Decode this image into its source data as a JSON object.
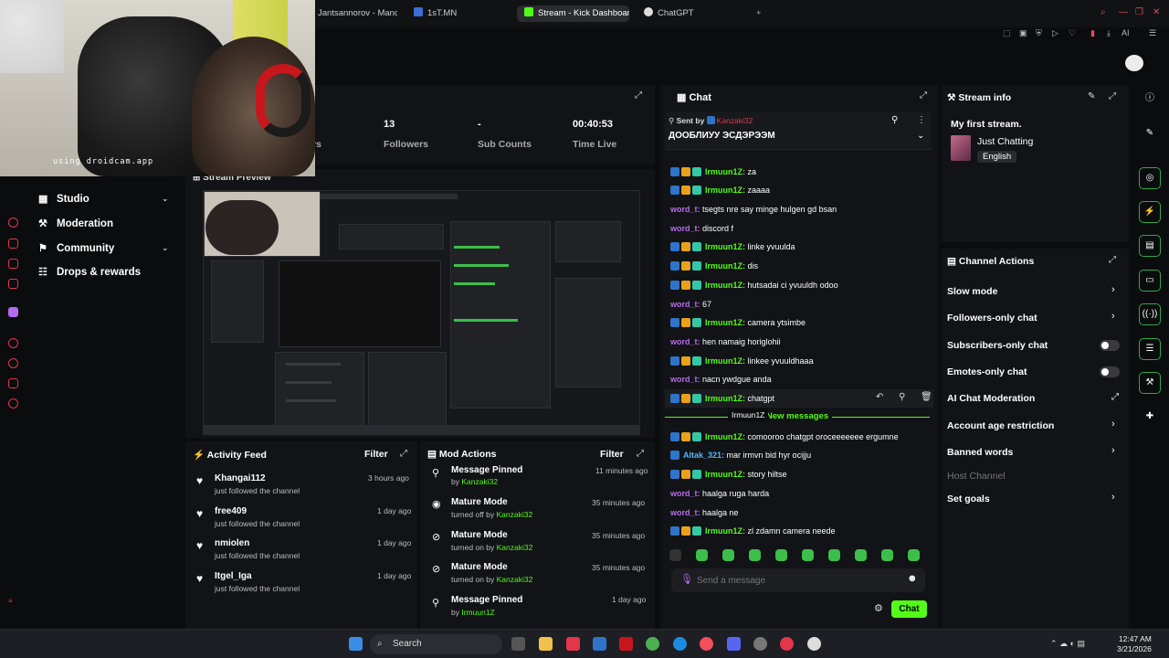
{
  "browser": {
    "tabs": [
      {
        "label": "Jantsannorov - Mand..."
      },
      {
        "label": "1sT.MN"
      },
      {
        "label": "Stream - Kick Dashboard"
      },
      {
        "label": "ChatGPT"
      }
    ],
    "new_tab": "+",
    "toolbar_ai": "AI"
  },
  "webcam": {
    "watermark": "using droidcam.app"
  },
  "nav": {
    "items": [
      {
        "label": "Studio",
        "icon": "studio-icon",
        "has_chevron": true
      },
      {
        "label": "Moderation",
        "icon": "moderation-icon",
        "has_chevron": false
      },
      {
        "label": "Community",
        "icon": "community-icon",
        "has_chevron": true
      },
      {
        "label": "Drops & rewards",
        "icon": "drops-icon",
        "has_chevron": false
      }
    ]
  },
  "stats": [
    {
      "value": "13",
      "label": "Followers"
    },
    {
      "value": "-",
      "label": "Sub Counts"
    },
    {
      "value": "00:40:53",
      "label": "Time Live"
    }
  ],
  "stats_partial_label": "rs",
  "preview": {
    "title": "Stream Preview"
  },
  "activity_feed": {
    "title": "Activity Feed",
    "filter": "Filter",
    "items": [
      {
        "name": "Khangai112",
        "sub": "just followed the channel",
        "time": "3 hours ago"
      },
      {
        "name": "free409",
        "sub": "just followed the channel",
        "time": "1 day ago"
      },
      {
        "name": "nmiolen",
        "sub": "just followed the channel",
        "time": "1 day ago"
      },
      {
        "name": "Itgel_Iga",
        "sub": "just followed the channel",
        "time": "1 day ago"
      }
    ]
  },
  "mod_actions": {
    "title": "Mod Actions",
    "filter": "Filter",
    "items": [
      {
        "action": "Message Pinned",
        "prefix": "by",
        "user": "Kanzaki32",
        "time": "11 minutes ago",
        "icon": "pin-icon"
      },
      {
        "action": "Mature Mode",
        "prefix": "turned off by",
        "user": "Kanzaki32",
        "time": "35 minutes ago",
        "icon": "eye-icon"
      },
      {
        "action": "Mature Mode",
        "prefix": "turned on by",
        "user": "Kanzaki32",
        "time": "35 minutes ago",
        "icon": "eye-off-icon"
      },
      {
        "action": "Mature Mode",
        "prefix": "turned on by",
        "user": "Kanzaki32",
        "time": "35 minutes ago",
        "icon": "eye-off-icon"
      },
      {
        "action": "Message Pinned",
        "prefix": "by",
        "user": "Irmuun1Z",
        "time": "1 day ago",
        "icon": "pin-icon"
      }
    ]
  },
  "chat": {
    "title": "Chat",
    "pinned": {
      "sent_by": "Sent by",
      "user": "Kanzaki32",
      "text": "ДООБЛИУУ ЭСДЭРЭЭМ"
    },
    "messages": [
      {
        "user": "Irmuun1Z:",
        "text": "za",
        "badges": true
      },
      {
        "user": "Irmuun1Z:",
        "text": "zaaaa",
        "badges": true
      },
      {
        "user": "word_t:",
        "text": "tsegts nre say minge hulgen gd bsan",
        "badges": false
      },
      {
        "user": "word_t:",
        "text": "discord f",
        "badges": false
      },
      {
        "user": "Irmuun1Z:",
        "text": "linke yvuulda",
        "badges": true
      },
      {
        "user": "Irmuun1Z:",
        "text": "dis",
        "badges": true
      },
      {
        "user": "Irmuun1Z:",
        "text": "hutsadai ci yvuuldh odoo",
        "badges": true
      },
      {
        "user": "word_t:",
        "text": "67",
        "badges": false
      },
      {
        "user": "Irmuun1Z:",
        "text": "camera ytsimbe",
        "badges": true
      },
      {
        "user": "word_t:",
        "text": "hen namaig horiglohii",
        "badges": false
      },
      {
        "user": "Irmuun1Z:",
        "text": "linkee yvuuldhaaa",
        "badges": true
      },
      {
        "user": "word_t:",
        "text": "nacn ywdgue anda",
        "badges": false
      },
      {
        "user": "Irmuun1Z:",
        "text": "chatgpt",
        "badges": true
      }
    ],
    "new_messages": "New messages",
    "tooltip": "Irmuun1Z",
    "messages_after": [
      {
        "user": "Irmuun1Z:",
        "text": "comooroo chatgpt oroceeeeeee ergumne",
        "badges": true
      },
      {
        "user": "Altak_321:",
        "text": "mar irmvn bid hyr ocijju",
        "badges": "single"
      },
      {
        "user": "Irmuun1Z:",
        "text": "story hiltse",
        "badges": true
      },
      {
        "user": "word_t:",
        "text": "haalga ruga harda",
        "badges": false
      },
      {
        "user": "word_t:",
        "text": "haalga ne",
        "badges": false
      },
      {
        "user": "Irmuun1Z:",
        "text": "zl zdamn camera neede",
        "badges": true
      }
    ],
    "placeholder": "Send a message",
    "send_button": "Chat"
  },
  "stream_info": {
    "title": "Stream info",
    "stream_title": "My first stream.",
    "category": "Just Chatting",
    "language": "English"
  },
  "channel_actions": {
    "title": "Channel Actions",
    "items": [
      {
        "label": "Slow mode",
        "control": "chevron"
      },
      {
        "label": "Followers-only chat",
        "control": "chevron"
      },
      {
        "label": "Subscribers-only chat",
        "control": "toggle"
      },
      {
        "label": "Emotes-only chat",
        "control": "toggle"
      },
      {
        "label": "AI Chat Moderation",
        "control": "external"
      },
      {
        "label": "Account age restriction",
        "control": "chevron"
      },
      {
        "label": "Banned words",
        "control": "chevron"
      },
      {
        "label": "Host Channel",
        "control": "none"
      },
      {
        "label": "Set goals",
        "control": "chevron"
      }
    ]
  },
  "taskbar": {
    "search": "Search",
    "time": "12:47 AM",
    "date": "3/21/2026"
  },
  "colors": {
    "accent": "#53fc18",
    "background": "#0b0c0e",
    "panel": "#121316",
    "danger": "#e2364a"
  }
}
